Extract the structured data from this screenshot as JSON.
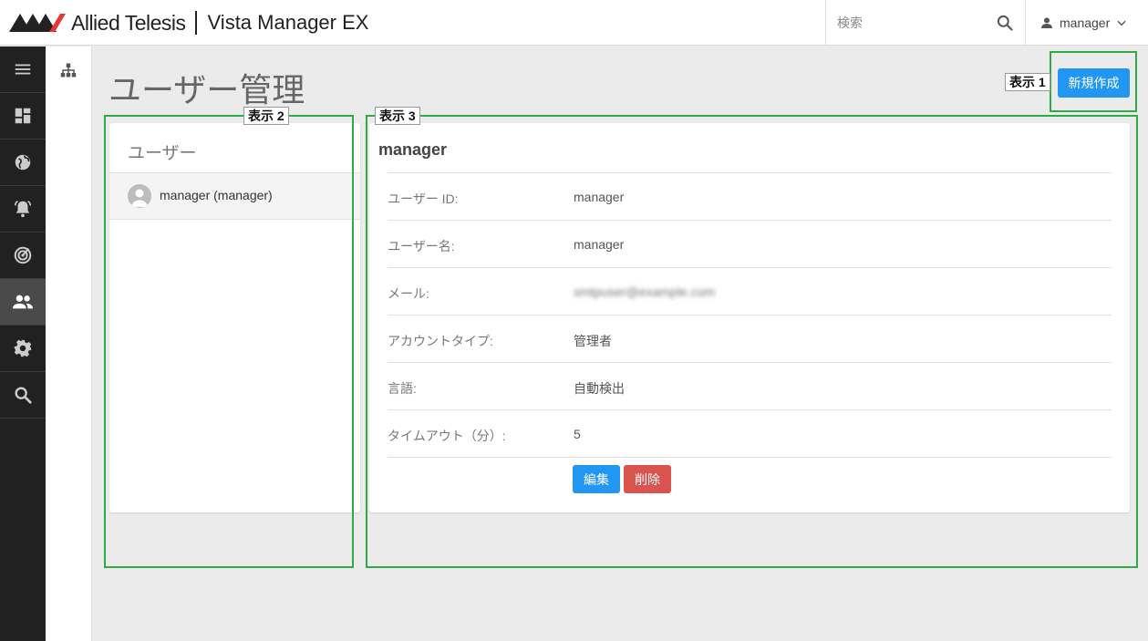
{
  "header": {
    "brand": "Allied Telesis",
    "product": "Vista Manager EX",
    "search_placeholder": "検索",
    "user_name": "manager",
    "icons": {
      "logo": "allied-telesis-logo",
      "search": "search-icon",
      "user": "person-icon",
      "chevron": "chevron-down-icon"
    }
  },
  "rail": {
    "items": [
      {
        "icon": "menu-icon",
        "active": false
      },
      {
        "icon": "dashboard-icon",
        "active": false
      },
      {
        "icon": "globe-icon",
        "active": false
      },
      {
        "icon": "alarm-bell-icon",
        "active": false
      },
      {
        "icon": "radar-icon",
        "active": false
      },
      {
        "icon": "users-icon",
        "active": true
      },
      {
        "icon": "gear-icon",
        "active": false
      },
      {
        "icon": "search-icon",
        "active": false
      }
    ]
  },
  "subbar": {
    "icon": "sitemap-icon"
  },
  "page": {
    "title": "ユーザー管理",
    "new_button": "新規作成"
  },
  "users_panel": {
    "heading": "ユーザー",
    "users": [
      {
        "label": "manager (manager)"
      }
    ]
  },
  "detail": {
    "title": "manager",
    "fields": [
      {
        "label": "ユーザー ID:",
        "value": "manager"
      },
      {
        "label": "ユーザー名:",
        "value": "manager"
      },
      {
        "label": "メール:",
        "value": "smtpuser@example.com"
      },
      {
        "label": "アカウントタイプ:",
        "value": "管理者"
      },
      {
        "label": "言語:",
        "value": "自動検出"
      },
      {
        "label": "タイムアウト（分）:",
        "value": "5"
      }
    ],
    "edit_button": "編集",
    "delete_button": "削除"
  },
  "annotations": [
    {
      "label": "表示 1"
    },
    {
      "label": "表示 2"
    },
    {
      "label": "表示 3"
    }
  ],
  "colors": {
    "accent": "#2196f3",
    "danger": "#d9534f",
    "rail": "#212121",
    "annotation": "#2eaa47"
  }
}
